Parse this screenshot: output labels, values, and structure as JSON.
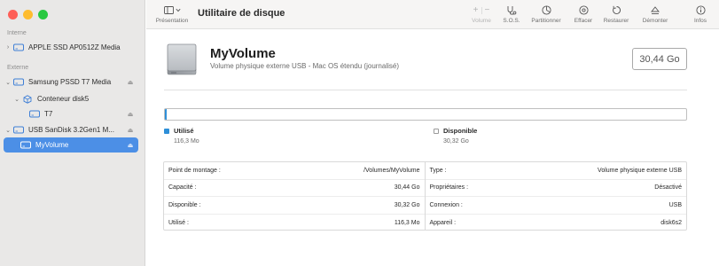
{
  "sidebar": {
    "sections": [
      {
        "label": "Interne"
      },
      {
        "label": "Externe"
      }
    ],
    "items": [
      {
        "label": "APPLE SSD AP0512Z Media"
      },
      {
        "label": "Samsung PSSD T7 Media"
      },
      {
        "label": "Conteneur disk5"
      },
      {
        "label": "T7"
      },
      {
        "label": "USB SanDisk 3.2Gen1 M..."
      },
      {
        "label": "MyVolume"
      }
    ]
  },
  "toolbar": {
    "presentation_label": "Présentation",
    "title": "Utilitaire de disque",
    "volume_label": "Volume",
    "sos_label": "S.O.S.",
    "partition_label": "Partitionner",
    "erase_label": "Effacer",
    "restore_label": "Restaurer",
    "unmount_label": "Démonter",
    "info_label": "Infos"
  },
  "volume": {
    "name": "MyVolume",
    "description": "Volume physique externe USB - Mac OS étendu (journalisé)",
    "capacity": "30,44 Go",
    "used_fraction": 0.004
  },
  "usage": {
    "used_label": "Utilisé",
    "used_value": "116,3 Mo",
    "free_label": "Disponible",
    "free_value": "30,32 Go"
  },
  "info": {
    "left": [
      {
        "label": "Point de montage :",
        "value": "/Volumes/MyVolume"
      },
      {
        "label": "Capacité :",
        "value": "30,44 Go"
      },
      {
        "label": "Disponible :",
        "value": "30,32 Go"
      },
      {
        "label": "Utilisé :",
        "value": "116,3 Mo"
      }
    ],
    "right": [
      {
        "label": "Type :",
        "value": "Volume physique externe USB"
      },
      {
        "label": "Propriétaires :",
        "value": "Désactivé"
      },
      {
        "label": "Connexion :",
        "value": "USB"
      },
      {
        "label": "Appareil :",
        "value": "disk6s2"
      }
    ]
  },
  "colors": {
    "accent": "#4c8fe6",
    "used": "#2e8fd8",
    "free": "#ffffff"
  }
}
